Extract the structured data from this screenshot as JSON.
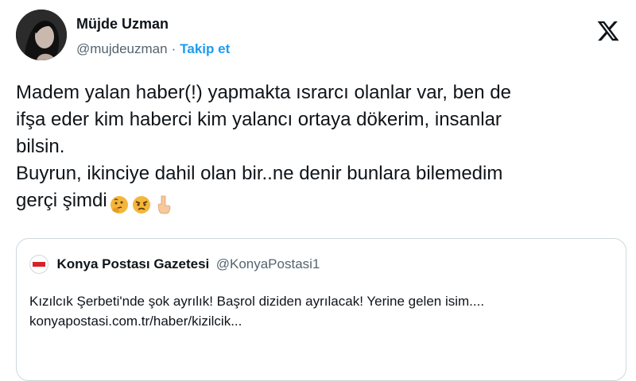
{
  "author": {
    "name": "Müjde Uzman",
    "handle": "@mujdeuzman",
    "separator": "·",
    "follow_label": "Takip et"
  },
  "brand": {
    "icon": "x-logo-icon"
  },
  "tweet": {
    "lines": [
      "Madem yalan haber(!) yapmakta ısrarcı olanlar var, ben de",
      "ifşa eder kim haberci kim yalancı ortaya dökerim, insanlar",
      "bilsin.",
      "Buyrun, ikinciye dahil olan bir..ne denir bunlara bilemedim",
      "gerçi şimdi"
    ],
    "emojis": [
      "thinking-face-emoji",
      "angry-face-emoji",
      "backhand-index-pointing-down-emoji"
    ]
  },
  "quote": {
    "name": "Konya Postası Gazetesi",
    "handle": "@KonyaPostasi1",
    "text": "Kızılcık Şerbeti'nde şok ayrılık! Başrol diziden ayrılacak! Yerine gelen isim....",
    "link": "konyapostasi.com.tr/haber/kizilcik..."
  },
  "colors": {
    "text": "#0f1419",
    "muted": "#536471",
    "accent": "#1d9bf0",
    "border": "#cfd9de"
  }
}
